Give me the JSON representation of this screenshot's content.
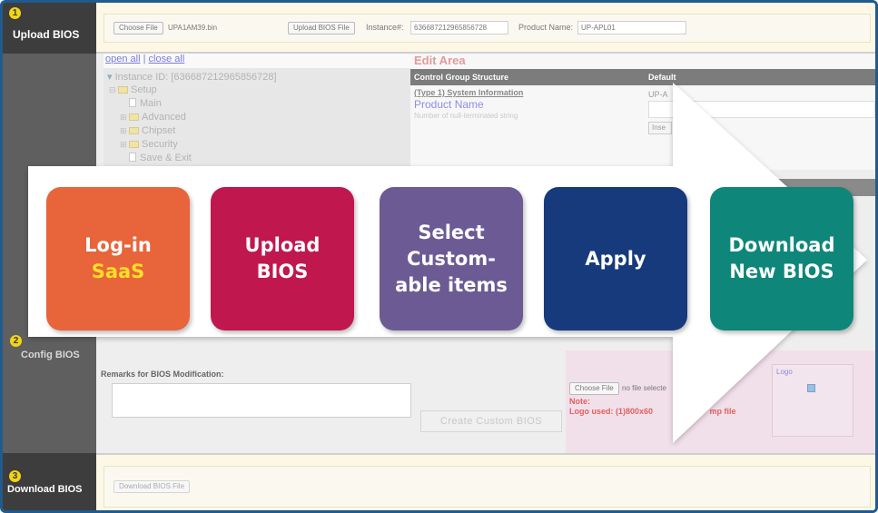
{
  "steps": [
    {
      "number": "1",
      "label": "Upload BIOS"
    },
    {
      "number": "2",
      "label": "Config BIOS"
    },
    {
      "number": "3",
      "label": "Download BIOS"
    }
  ],
  "upload_bar": {
    "choose_file_button": "Choose File",
    "file_name": "UPA1AM39.bin",
    "upload_button": "Upload BIOS File",
    "instance_label": "Instance#:",
    "instance_value": "636687212965856728",
    "product_label": "Product Name:",
    "product_value": "UP-APL01"
  },
  "tree": {
    "open_all": "open all",
    "separator": "|",
    "close_all": "close all",
    "instance_id": "Instance ID: [636687212965856728]",
    "items": [
      "Setup",
      "Main",
      "Advanced",
      "Chipset",
      "Security",
      "Save & Exit"
    ]
  },
  "edit_area": {
    "title": "Edit Area",
    "col_structure": "Control Group Structure",
    "col_default": "Default",
    "type_line": "(Type 1) System Information",
    "product_name": "Product Name",
    "hint": "Number of null-terminated string",
    "default_value": "UP-A",
    "insert_button": "Inse"
  },
  "config": {
    "remarks_label": "Remarks for BIOS Modification:",
    "create_button": "Create Custom BIOS",
    "choose_file_button": "Choose File",
    "no_file_text": "no file selecte",
    "note_label": "Note:",
    "logo_used": "Logo used: (1)800x60",
    "logo_used_tail": "mp file",
    "logo_label": "Logo"
  },
  "download_bar": {
    "download_button": "Download BIOS File"
  },
  "process_steps": [
    {
      "lines": [
        "Log-in",
        "SaaS"
      ],
      "highlight": "SaaS",
      "color": "#e8643a"
    },
    {
      "lines": [
        "Upload",
        "BIOS"
      ],
      "color": "#c0174f"
    },
    {
      "lines": [
        "Select",
        "Custom-",
        "able items"
      ],
      "color": "#6c5a94"
    },
    {
      "lines": [
        "Apply"
      ],
      "color": "#173a7c"
    },
    {
      "lines": [
        "Download",
        "New BIOS"
      ],
      "color": "#0e877a"
    }
  ],
  "highlight_color": "#ffde2a"
}
